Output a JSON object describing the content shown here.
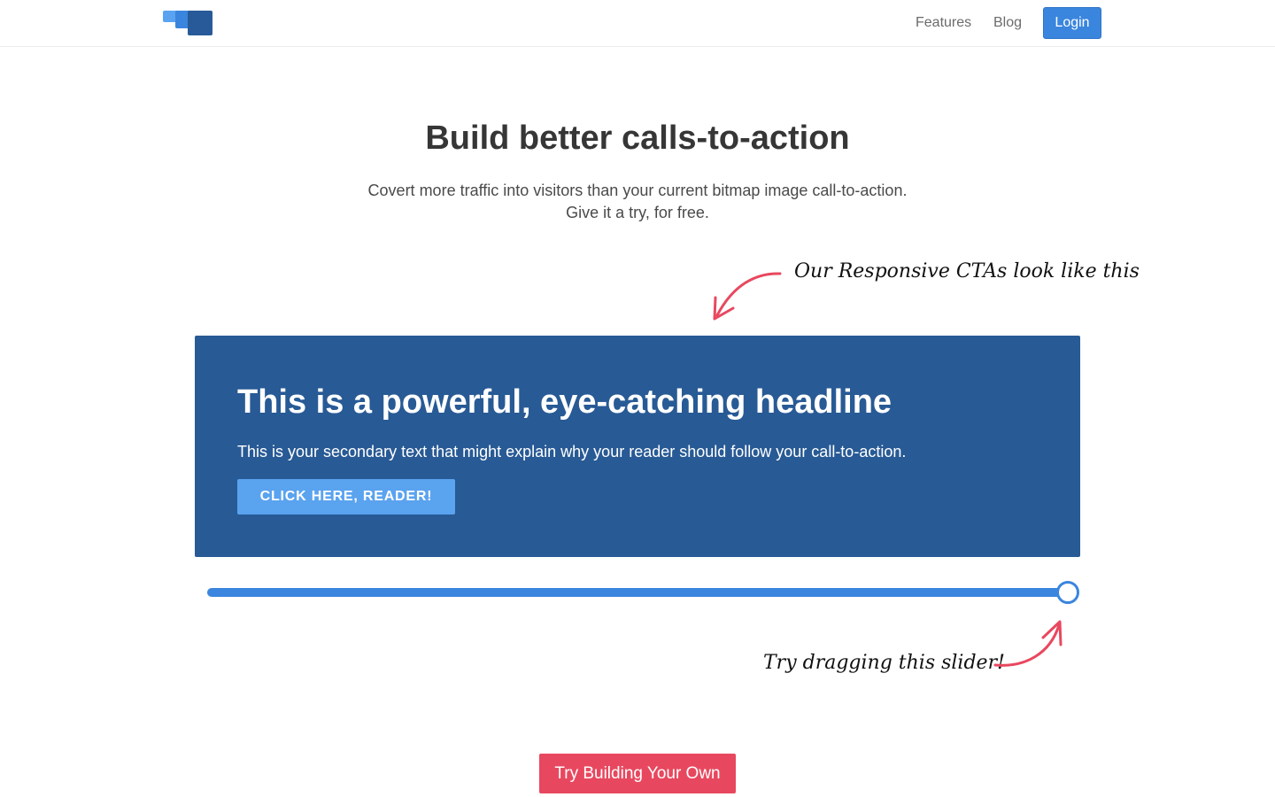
{
  "nav": {
    "logo_icon": "stacked-blocks-logo",
    "links": [
      {
        "label": "Features"
      },
      {
        "label": "Blog"
      }
    ],
    "login_label": "Login"
  },
  "hero": {
    "title": "Build better calls-to-action",
    "subtitle_line1": "Covert more traffic into visitors than your current bitmap image call-to-action.",
    "subtitle_line2": "Give it a try, for free."
  },
  "annotations": {
    "top": "Our Responsive CTAs look like this",
    "bottom": "Try dragging this slider!"
  },
  "cta": {
    "headline": "This is a powerful, eye-catching headline",
    "text": "This is your secondary text that might explain why your reader should follow your call-to-action.",
    "button_label": "CLICK HERE, READER!"
  },
  "slider": {
    "value_percent": 100
  },
  "footer_cta": {
    "label": "Try Building Your Own"
  },
  "colors": {
    "primary": "#3a85de",
    "cta_background": "#285a95",
    "cta_button": "#5aa3ef",
    "accent": "#e8485f",
    "annotation_arrow": "#e8485f"
  }
}
